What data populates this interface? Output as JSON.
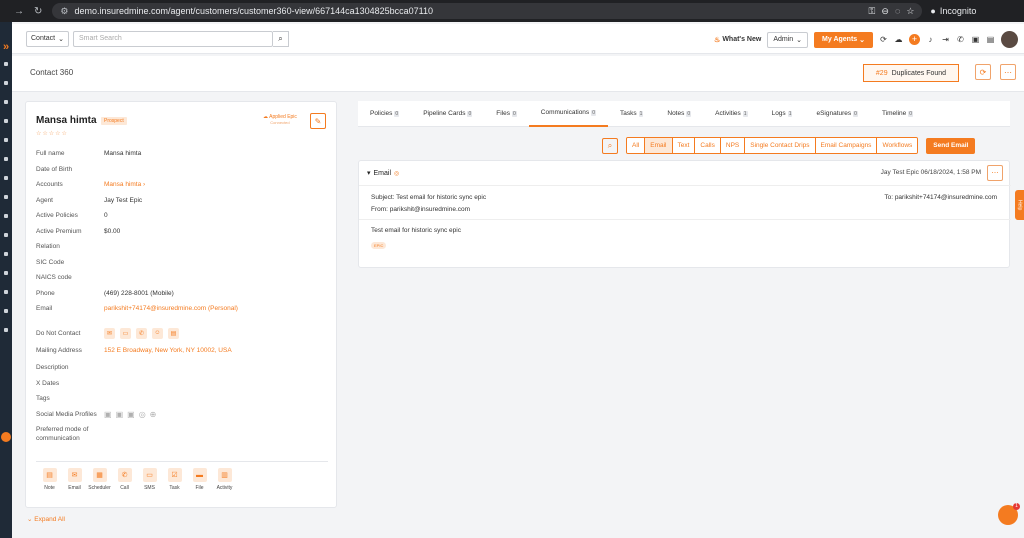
{
  "browser": {
    "url": "demo.insuredmine.com/agent/customers/customer360-view/667144ca1304825bcca07110",
    "incognito": "Incognito"
  },
  "topbar": {
    "entity_select": "Contact",
    "search_placeholder": "Smart Search",
    "whats_new": "What's New",
    "admin": "Admin",
    "my_agents": "My Agents"
  },
  "page": {
    "title": "Contact 360",
    "dup_number": "#29",
    "dup_label": "Duplicates Found"
  },
  "contact": {
    "name": "Mansa himta",
    "badge": "Prospect",
    "epic_label": "Applied Epic",
    "epic_sub": "Connected",
    "fields": [
      {
        "label": "Full name",
        "value": "Mansa himta"
      },
      {
        "label": "Date of Birth",
        "value": ""
      },
      {
        "label": "Accounts",
        "value": "Mansa himta  ›"
      },
      {
        "label": "Agent",
        "value": "Jay Test Epic"
      },
      {
        "label": "Active Policies",
        "value": "0"
      },
      {
        "label": "Active Premium",
        "value": "$0.00"
      },
      {
        "label": "Relation",
        "value": ""
      },
      {
        "label": "SIC Code",
        "value": ""
      },
      {
        "label": "NAICS code",
        "value": ""
      },
      {
        "label": "Phone",
        "value": "(469) 228-8001 (Mobile)"
      },
      {
        "label": "Email",
        "value": "parikshit+74174@insuredmine.com   (Personal)"
      }
    ],
    "fields2": [
      {
        "label": "Do Not Contact"
      },
      {
        "label": "Mailing Address",
        "value": "152 E Broadway, New York, NY 10002, USA"
      },
      {
        "label": "Description"
      },
      {
        "label": "X Dates"
      },
      {
        "label": "Tags"
      },
      {
        "label": "Social Media Profiles"
      },
      {
        "label": "Preferred mode of"
      },
      {
        "label": "communication"
      }
    ],
    "actions": [
      "Note",
      "Email",
      "Scheduler",
      "Call",
      "SMS",
      "Task",
      "File",
      "Activity"
    ],
    "expand": "Expand All"
  },
  "tabs": [
    {
      "label": "Policies",
      "count": "0"
    },
    {
      "label": "Pipeline Cards",
      "count": "0"
    },
    {
      "label": "Files",
      "count": "0"
    },
    {
      "label": "Communications",
      "count": "0"
    },
    {
      "label": "Tasks",
      "count": "1"
    },
    {
      "label": "Notes",
      "count": "0"
    },
    {
      "label": "Activities",
      "count": "1"
    },
    {
      "label": "Logs",
      "count": "1"
    },
    {
      "label": "eSignatures",
      "count": "0"
    },
    {
      "label": "Timeline",
      "count": "0"
    }
  ],
  "filters": [
    "All",
    "Email",
    "Text",
    "Calls",
    "NPS",
    "Single Contact Drips",
    "Email Campaigns",
    "Workflows"
  ],
  "send_email": "Send Email",
  "email": {
    "section": "Email",
    "meta": "Jay Test Epic 06/18/2024, 1:58 PM",
    "subject": "Subject: Test email for historic sync epic",
    "from": "From: parikshit@insuredmine.com",
    "to": "To: parikshit+74174@insuredmine.com",
    "body": "Test email for historic sync epic",
    "tag": "EPIC"
  },
  "help": "Help",
  "chat_badge": "1",
  "colors": {
    "accent": "#f47b20"
  }
}
